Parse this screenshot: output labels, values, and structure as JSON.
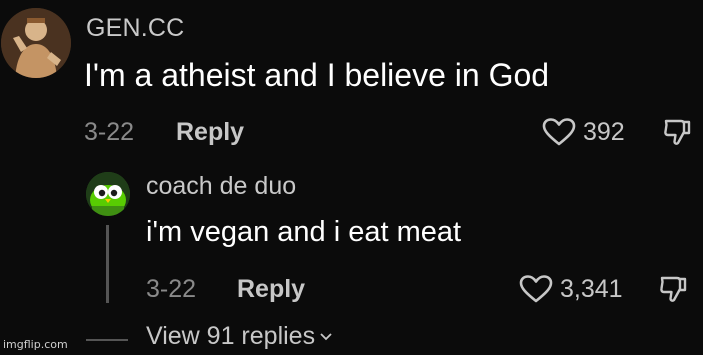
{
  "comment": {
    "author": "GEN.CC",
    "text": "I'm a atheist and I believe in God",
    "date": "3-22",
    "reply_label": "Reply",
    "likes": "392",
    "avatar_icon": "statue-avatar-icon"
  },
  "reply": {
    "author": "coach de duo",
    "text": "i'm vegan and i eat meat",
    "date": "3-22",
    "reply_label": "Reply",
    "likes": "3,341",
    "avatar_icon": "duolingo-owl-avatar-icon"
  },
  "view_replies": {
    "label": "View 91 replies",
    "icon": "chevron-down-icon"
  },
  "watermark": "imgflip.com",
  "colors": {
    "background": "#0b0b0b",
    "primary_text": "#ffffff",
    "secondary_text": "#c9c9c9",
    "muted_text": "#8a8a8a",
    "thread_line": "#555555",
    "duo_green": "#58cc02"
  }
}
